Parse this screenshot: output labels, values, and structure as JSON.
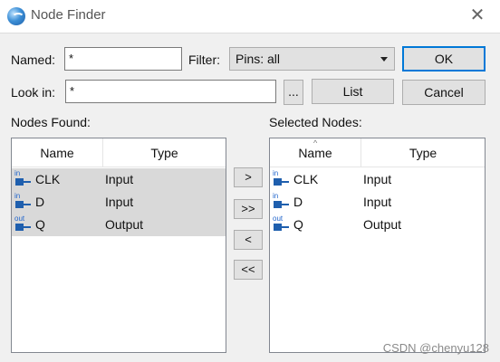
{
  "window": {
    "title": "Node Finder",
    "icon": "app-globe-icon",
    "close_icon": "close-icon"
  },
  "named": {
    "label": "Named:",
    "value": "*"
  },
  "filter": {
    "label": "Filter:",
    "value": "Pins: all"
  },
  "look_in": {
    "label": "Look in:",
    "value": "*",
    "browse_label": "..."
  },
  "buttons": {
    "ok": "OK",
    "list": "List",
    "cancel": "Cancel"
  },
  "nodes_found": {
    "label": "Nodes Found:",
    "columns": [
      "Name",
      "Type"
    ],
    "rows": [
      {
        "pin": "in",
        "name": "CLK",
        "type": "Input"
      },
      {
        "pin": "in",
        "name": "D",
        "type": "Input"
      },
      {
        "pin": "out",
        "name": "Q",
        "type": "Output"
      }
    ]
  },
  "transfer": {
    "add": ">",
    "add_all": ">>",
    "remove": "<",
    "remove_all": "<<"
  },
  "selected_nodes": {
    "label": "Selected Nodes:",
    "columns": [
      "Name",
      "Type"
    ],
    "rows": [
      {
        "pin": "in",
        "name": "CLK",
        "type": "Input"
      },
      {
        "pin": "in",
        "name": "D",
        "type": "Input"
      },
      {
        "pin": "out",
        "name": "Q",
        "type": "Output"
      }
    ]
  },
  "watermark": "CSDN @chenyu128",
  "colors": {
    "accent": "#0078d7",
    "pin_icon": "#1f5fae",
    "selection": "#d9d9d9"
  }
}
